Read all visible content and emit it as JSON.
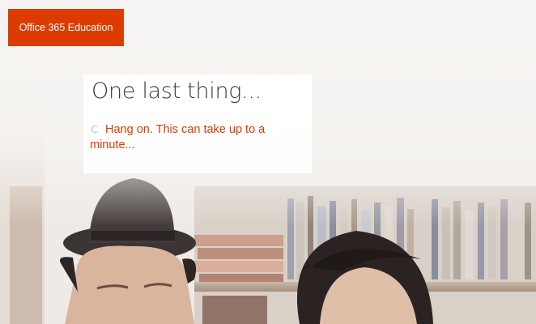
{
  "brand": {
    "label": "Office 365 Education",
    "color": "#dc3c00"
  },
  "card": {
    "title": "One last thing...",
    "status_text": "Hang on. This can take up to a minute...",
    "status_color": "#dc3c00",
    "status_icon": "loading-spinner-icon"
  }
}
